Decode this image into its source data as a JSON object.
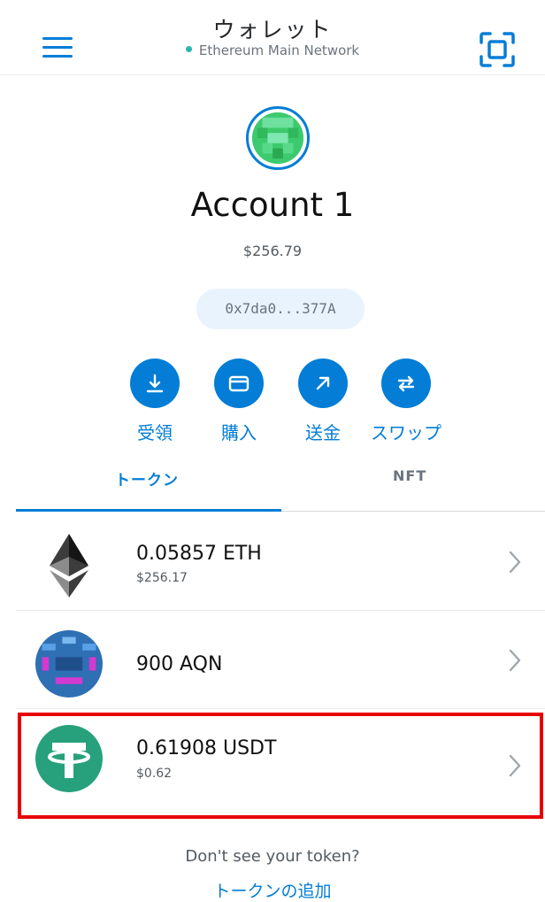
{
  "header": {
    "title": "ウォレット",
    "network": "Ethereum Main Network"
  },
  "account": {
    "name": "Account 1",
    "balance": "$256.79",
    "address": "0x7da0...377A"
  },
  "actions": [
    {
      "label": "受領",
      "icon": "receive-icon"
    },
    {
      "label": "購入",
      "icon": "buy-icon"
    },
    {
      "label": "送金",
      "icon": "send-icon"
    },
    {
      "label": "スワップ",
      "icon": "swap-icon"
    }
  ],
  "tabs": {
    "tokens": "トークン",
    "nft": "NFT"
  },
  "tokens": [
    {
      "amount": "0.05857 ETH",
      "fiat": "$256.17",
      "icon": "ethereum-icon"
    },
    {
      "amount": "900 AQN",
      "fiat": "",
      "icon": "aqn-icon"
    },
    {
      "amount": "0.61908 USDT",
      "fiat": "$0.62",
      "icon": "tether-icon"
    }
  ],
  "footer": {
    "dont_see": "Don't see your token?",
    "add_token": "トークンの追加"
  },
  "colors": {
    "accent": "#037dd6",
    "highlight": "#e80000",
    "tether": "#26a17b"
  }
}
